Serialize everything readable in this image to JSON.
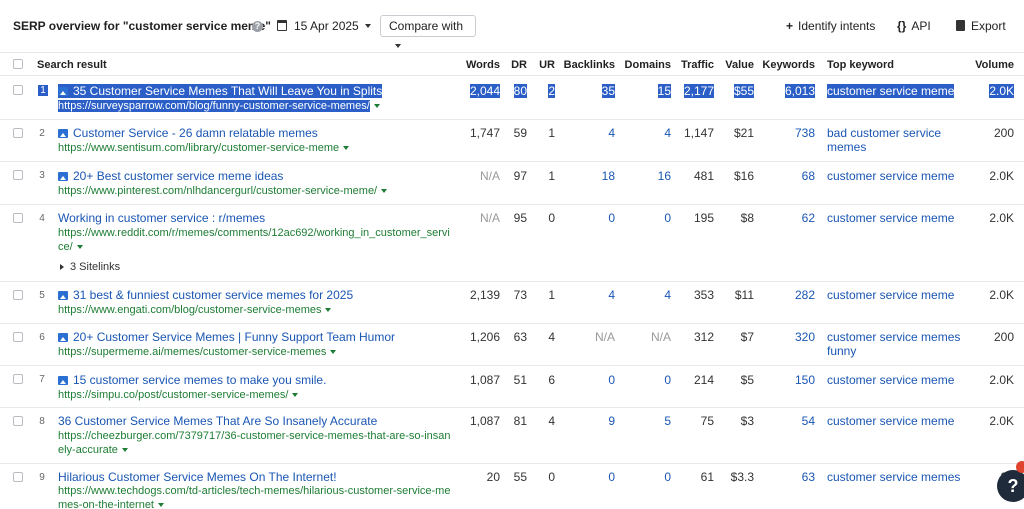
{
  "header": {
    "title": "SERP overview for \"customer service meme\"",
    "help_icon": "?",
    "date": "15 Apr 2025",
    "compare_label": "Compare with",
    "identify_label": "Identify intents",
    "api_label": "API",
    "export_label": "Export"
  },
  "columns": {
    "search_result": "Search result",
    "words": "Words",
    "dr": "DR",
    "ur": "UR",
    "backlinks": "Backlinks",
    "domains": "Domains",
    "traffic": "Traffic",
    "value": "Value",
    "keywords": "Keywords",
    "top_keyword": "Top keyword",
    "volume": "Volume"
  },
  "rows": [
    {
      "n": "1",
      "title": "35 Customer Service Memes That Will Leave You in Splits",
      "url": "https://surveysparrow.com/blog/funny-customer-service-memes/",
      "words": "2,044",
      "dr": "80",
      "ur": "2",
      "backlinks": "35",
      "domains": "15",
      "traffic": "2,177",
      "value": "$55",
      "keywords": "6,013",
      "top_keyword": "customer service meme",
      "volume": "2.0K"
    },
    {
      "n": "2",
      "title": "Customer Service - 26 damn relatable memes",
      "url": "https://www.sentisum.com/library/customer-service-meme",
      "words": "1,747",
      "dr": "59",
      "ur": "1",
      "backlinks": "4",
      "domains": "4",
      "traffic": "1,147",
      "value": "$21",
      "keywords": "738",
      "top_keyword": "bad customer service memes",
      "volume": "200"
    },
    {
      "n": "3",
      "title": "20+ Best customer service meme ideas",
      "url": "https://www.pinterest.com/nlhdancergurl/customer-service-meme/",
      "words": "N/A",
      "dr": "97",
      "ur": "1",
      "backlinks": "18",
      "domains": "16",
      "traffic": "481",
      "value": "$16",
      "keywords": "68",
      "top_keyword": "customer service meme",
      "volume": "2.0K"
    },
    {
      "n": "4",
      "title": "Working in customer service : r/memes",
      "url": "https://www.reddit.com/r/memes/comments/12ac692/working_in_customer_service/",
      "sitelinks": "3 Sitelinks",
      "words": "N/A",
      "dr": "95",
      "ur": "0",
      "backlinks": "0",
      "domains": "0",
      "traffic": "195",
      "value": "$8",
      "keywords": "62",
      "top_keyword": "customer service meme",
      "volume": "2.0K"
    },
    {
      "n": "5",
      "title": "31 best & funniest customer service memes for 2025",
      "url": "https://www.engati.com/blog/customer-service-memes",
      "words": "2,139",
      "dr": "73",
      "ur": "1",
      "backlinks": "4",
      "domains": "4",
      "traffic": "353",
      "value": "$11",
      "keywords": "282",
      "top_keyword": "customer service meme",
      "volume": "2.0K"
    },
    {
      "n": "6",
      "title": "20+ Customer Service Memes | Funny Support Team Humor",
      "url": "https://supermeme.ai/memes/customer-service-memes",
      "words": "1,206",
      "dr": "63",
      "ur": "4",
      "backlinks": "N/A",
      "domains": "N/A",
      "traffic": "312",
      "value": "$7",
      "keywords": "320",
      "top_keyword": "customer service memes funny",
      "volume": "200"
    },
    {
      "n": "7",
      "title": "15 customer service memes to make you smile.",
      "url": "https://simpu.co/post/customer-service-memes/",
      "words": "1,087",
      "dr": "51",
      "ur": "6",
      "backlinks": "0",
      "domains": "0",
      "traffic": "214",
      "value": "$5",
      "keywords": "150",
      "top_keyword": "customer service meme",
      "volume": "2.0K"
    },
    {
      "n": "8",
      "title": "36 Customer Service Memes That Are So Insanely Accurate",
      "url": "https://cheezburger.com/7379717/36-customer-service-memes-that-are-so-insanely-accurate",
      "words": "1,087",
      "dr": "81",
      "ur": "4",
      "backlinks": "9",
      "domains": "5",
      "traffic": "75",
      "value": "$3",
      "keywords": "54",
      "top_keyword": "customer service meme",
      "volume": "2.0K"
    },
    {
      "n": "9",
      "title": "Hilarious Customer Service Memes On The Internet!",
      "url": "https://www.techdogs.com/td-articles/tech-memes/hilarious-customer-service-memes-on-the-internet",
      "words": "20",
      "dr": "55",
      "ur": "0",
      "backlinks": "0",
      "domains": "0",
      "traffic": "61",
      "value": "$3.3",
      "keywords": "63",
      "top_keyword": "customer service memes",
      "volume": "80"
    }
  ],
  "row4_url_lines": [
    "https://www.reddit.com/r/memes/comments/12ac692/working_in_customer_servi",
    "ce/"
  ],
  "row8_url_lines": [
    "https://cheezburger.com/7379717/36-customer-service-memes-that-are-so-insan",
    "ely-accurate"
  ],
  "row9_url_lines": [
    "https://www.techdogs.com/td-articles/tech-memes/hilarious-customer-service-me",
    "mes-on-the-internet"
  ],
  "row2_kw_lines": [
    "bad customer service",
    "memes"
  ],
  "row6_kw_lines": [
    "customer service memes",
    "funny"
  ],
  "help_fab": "?",
  "colors": {
    "link": "#1a56b3",
    "url": "#1e7d34",
    "selection": "#2b5fc7"
  }
}
